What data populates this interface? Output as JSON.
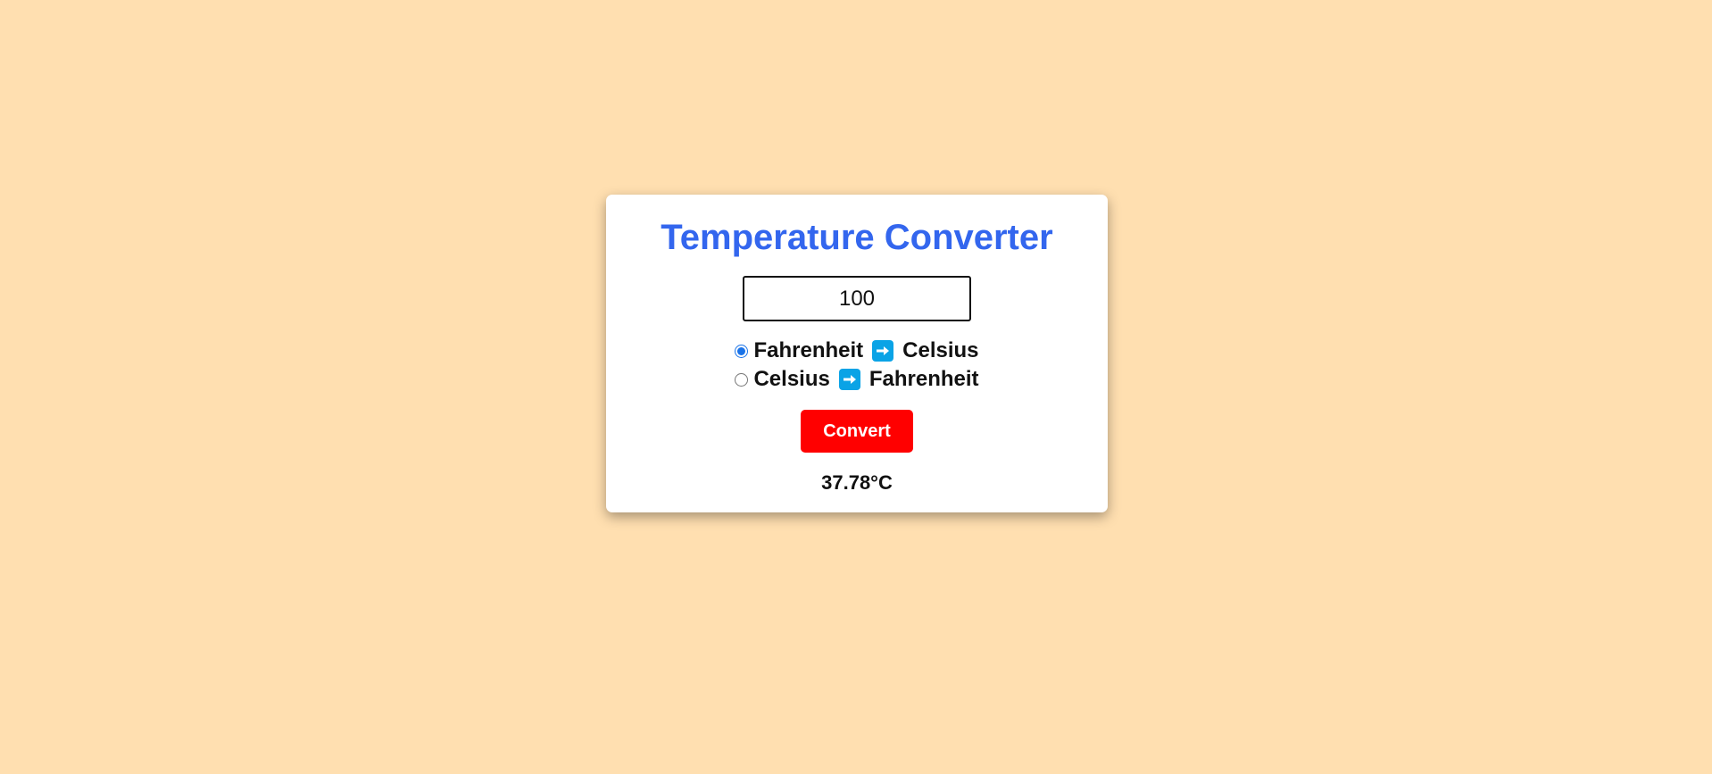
{
  "theme": {
    "background": "#FFDFB0",
    "title_color": "#3366EE",
    "button_color": "#FF0000",
    "arrow_color": "#0AA3E6"
  },
  "converter": {
    "title": "Temperature Converter",
    "input_value": "100",
    "options": [
      {
        "from": "Fahrenheit",
        "arrow_icon": "right-arrow-icon",
        "to": "Celsius",
        "selected": true
      },
      {
        "from": "Celsius",
        "arrow_icon": "right-arrow-icon",
        "to": "Fahrenheit",
        "selected": false
      }
    ],
    "convert_label": "Convert",
    "result": "37.78°C"
  }
}
